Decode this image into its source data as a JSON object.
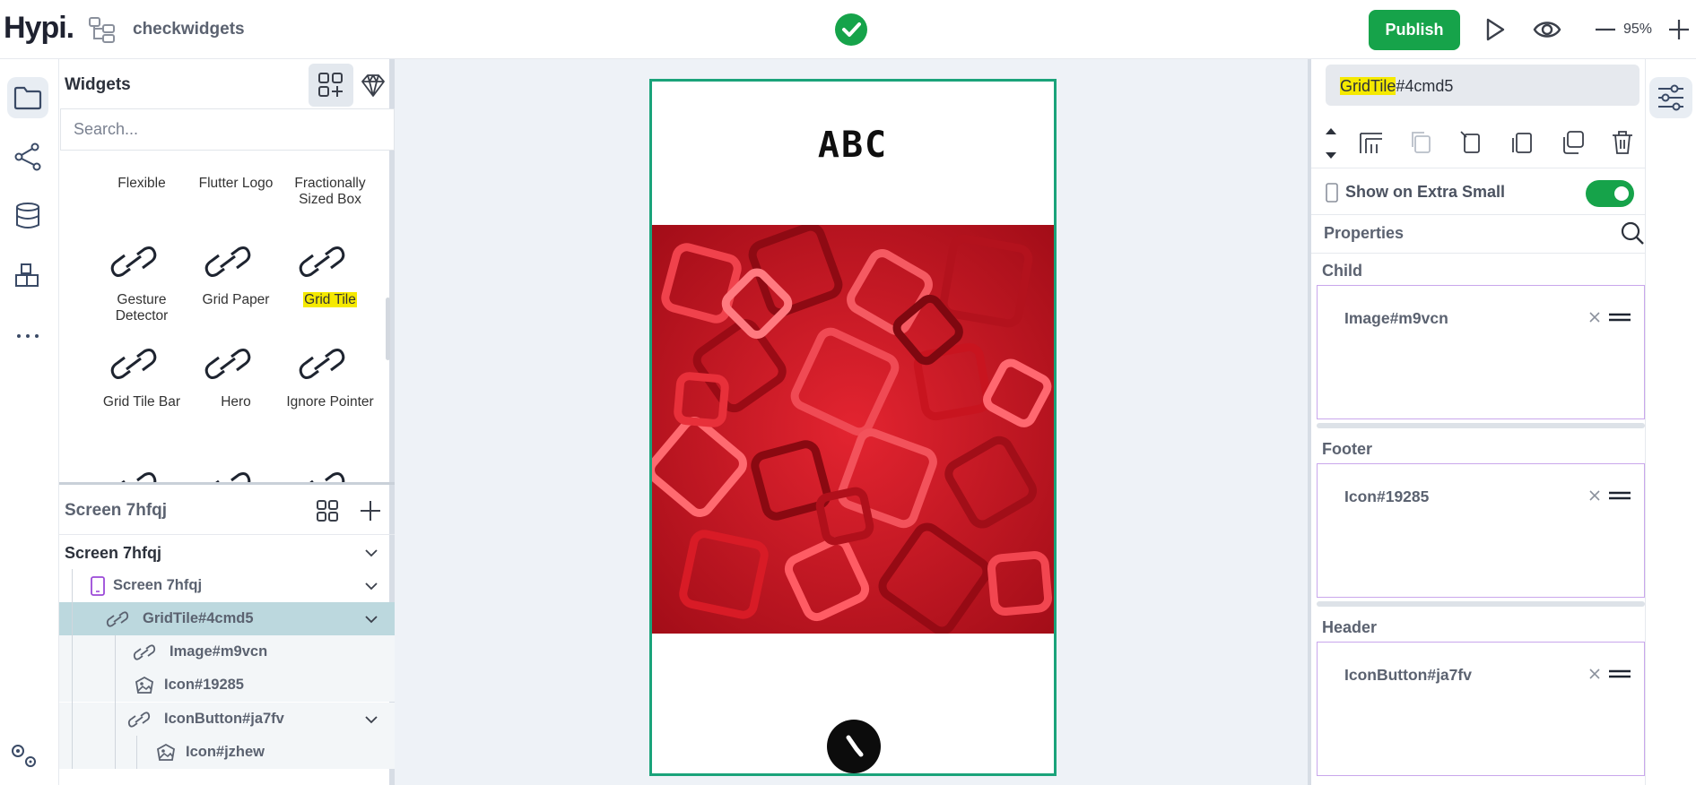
{
  "header": {
    "logo": "Hypi.",
    "project_name": "checkwidgets",
    "publish_label": "Publish",
    "zoom": "95%"
  },
  "widgets_panel": {
    "title": "Widgets",
    "search_placeholder": "Search...",
    "items": [
      {
        "label": "Flexible"
      },
      {
        "label": "Flutter Logo"
      },
      {
        "label": "Fractionally Sized Box"
      },
      {
        "label": "Gesture Detector"
      },
      {
        "label": "Grid Paper"
      },
      {
        "label": "Grid Tile",
        "highlighted": true
      },
      {
        "label": "Grid Tile Bar"
      },
      {
        "label": "Hero"
      },
      {
        "label": "Ignore Pointer"
      }
    ]
  },
  "screens": {
    "header_title": "Screen 7hfqj",
    "tree": [
      {
        "label": "Screen 7hfqj"
      },
      {
        "label": "Screen 7hfqj"
      },
      {
        "label": "GridTile#4cmd5",
        "selected": true
      },
      {
        "label": "Image#m9vcn"
      },
      {
        "label": "Icon#19285"
      },
      {
        "label": "IconButton#ja7fv"
      },
      {
        "label": "Icon#jzhew"
      }
    ]
  },
  "canvas": {
    "title_text": "ABC"
  },
  "properties": {
    "selected_type": "GridTile",
    "selected_id": "#4cmd5",
    "show_on_label": "Show on Extra Small",
    "show_on_enabled": true,
    "properties_title": "Properties",
    "slots": [
      {
        "label": "Child",
        "value": "Image#m9vcn"
      },
      {
        "label": "Footer",
        "value": "Icon#19285"
      },
      {
        "label": "Header",
        "value": "IconButton#ja7fv"
      }
    ]
  },
  "colors": {
    "brand_green": "#16a34a",
    "device_border": "#1aa37a",
    "highlight": "#f5e900",
    "selection_row": "#bcd8de",
    "slot_border": "#c9a7ec"
  }
}
